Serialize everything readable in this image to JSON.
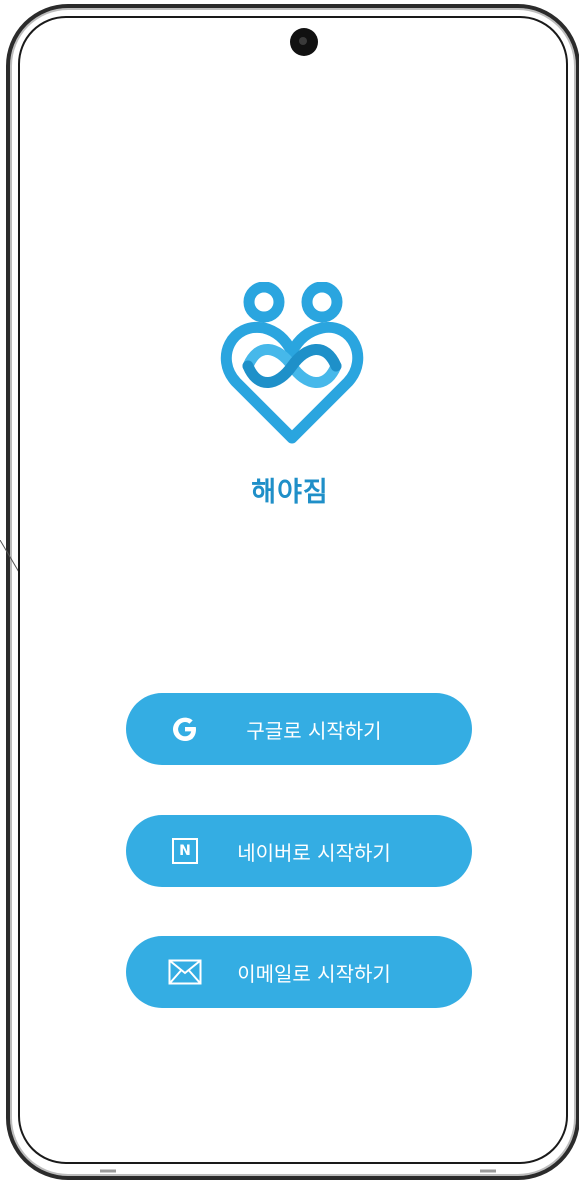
{
  "app": {
    "name": "해야짐"
  },
  "login": {
    "google_label": "구글로 시작하기",
    "naver_label": "네이버로 시작하기",
    "naver_icon_letter": "N",
    "email_label": "이메일로 시작하기"
  },
  "icons": {
    "google": "google-g-icon",
    "naver": "naver-n-icon",
    "email": "envelope-icon",
    "logo": "heart-people-infinity-logo"
  },
  "colors": {
    "brand_blue": "#34ade3",
    "title_blue": "#1f8fc8",
    "button_text": "#ffffff"
  }
}
